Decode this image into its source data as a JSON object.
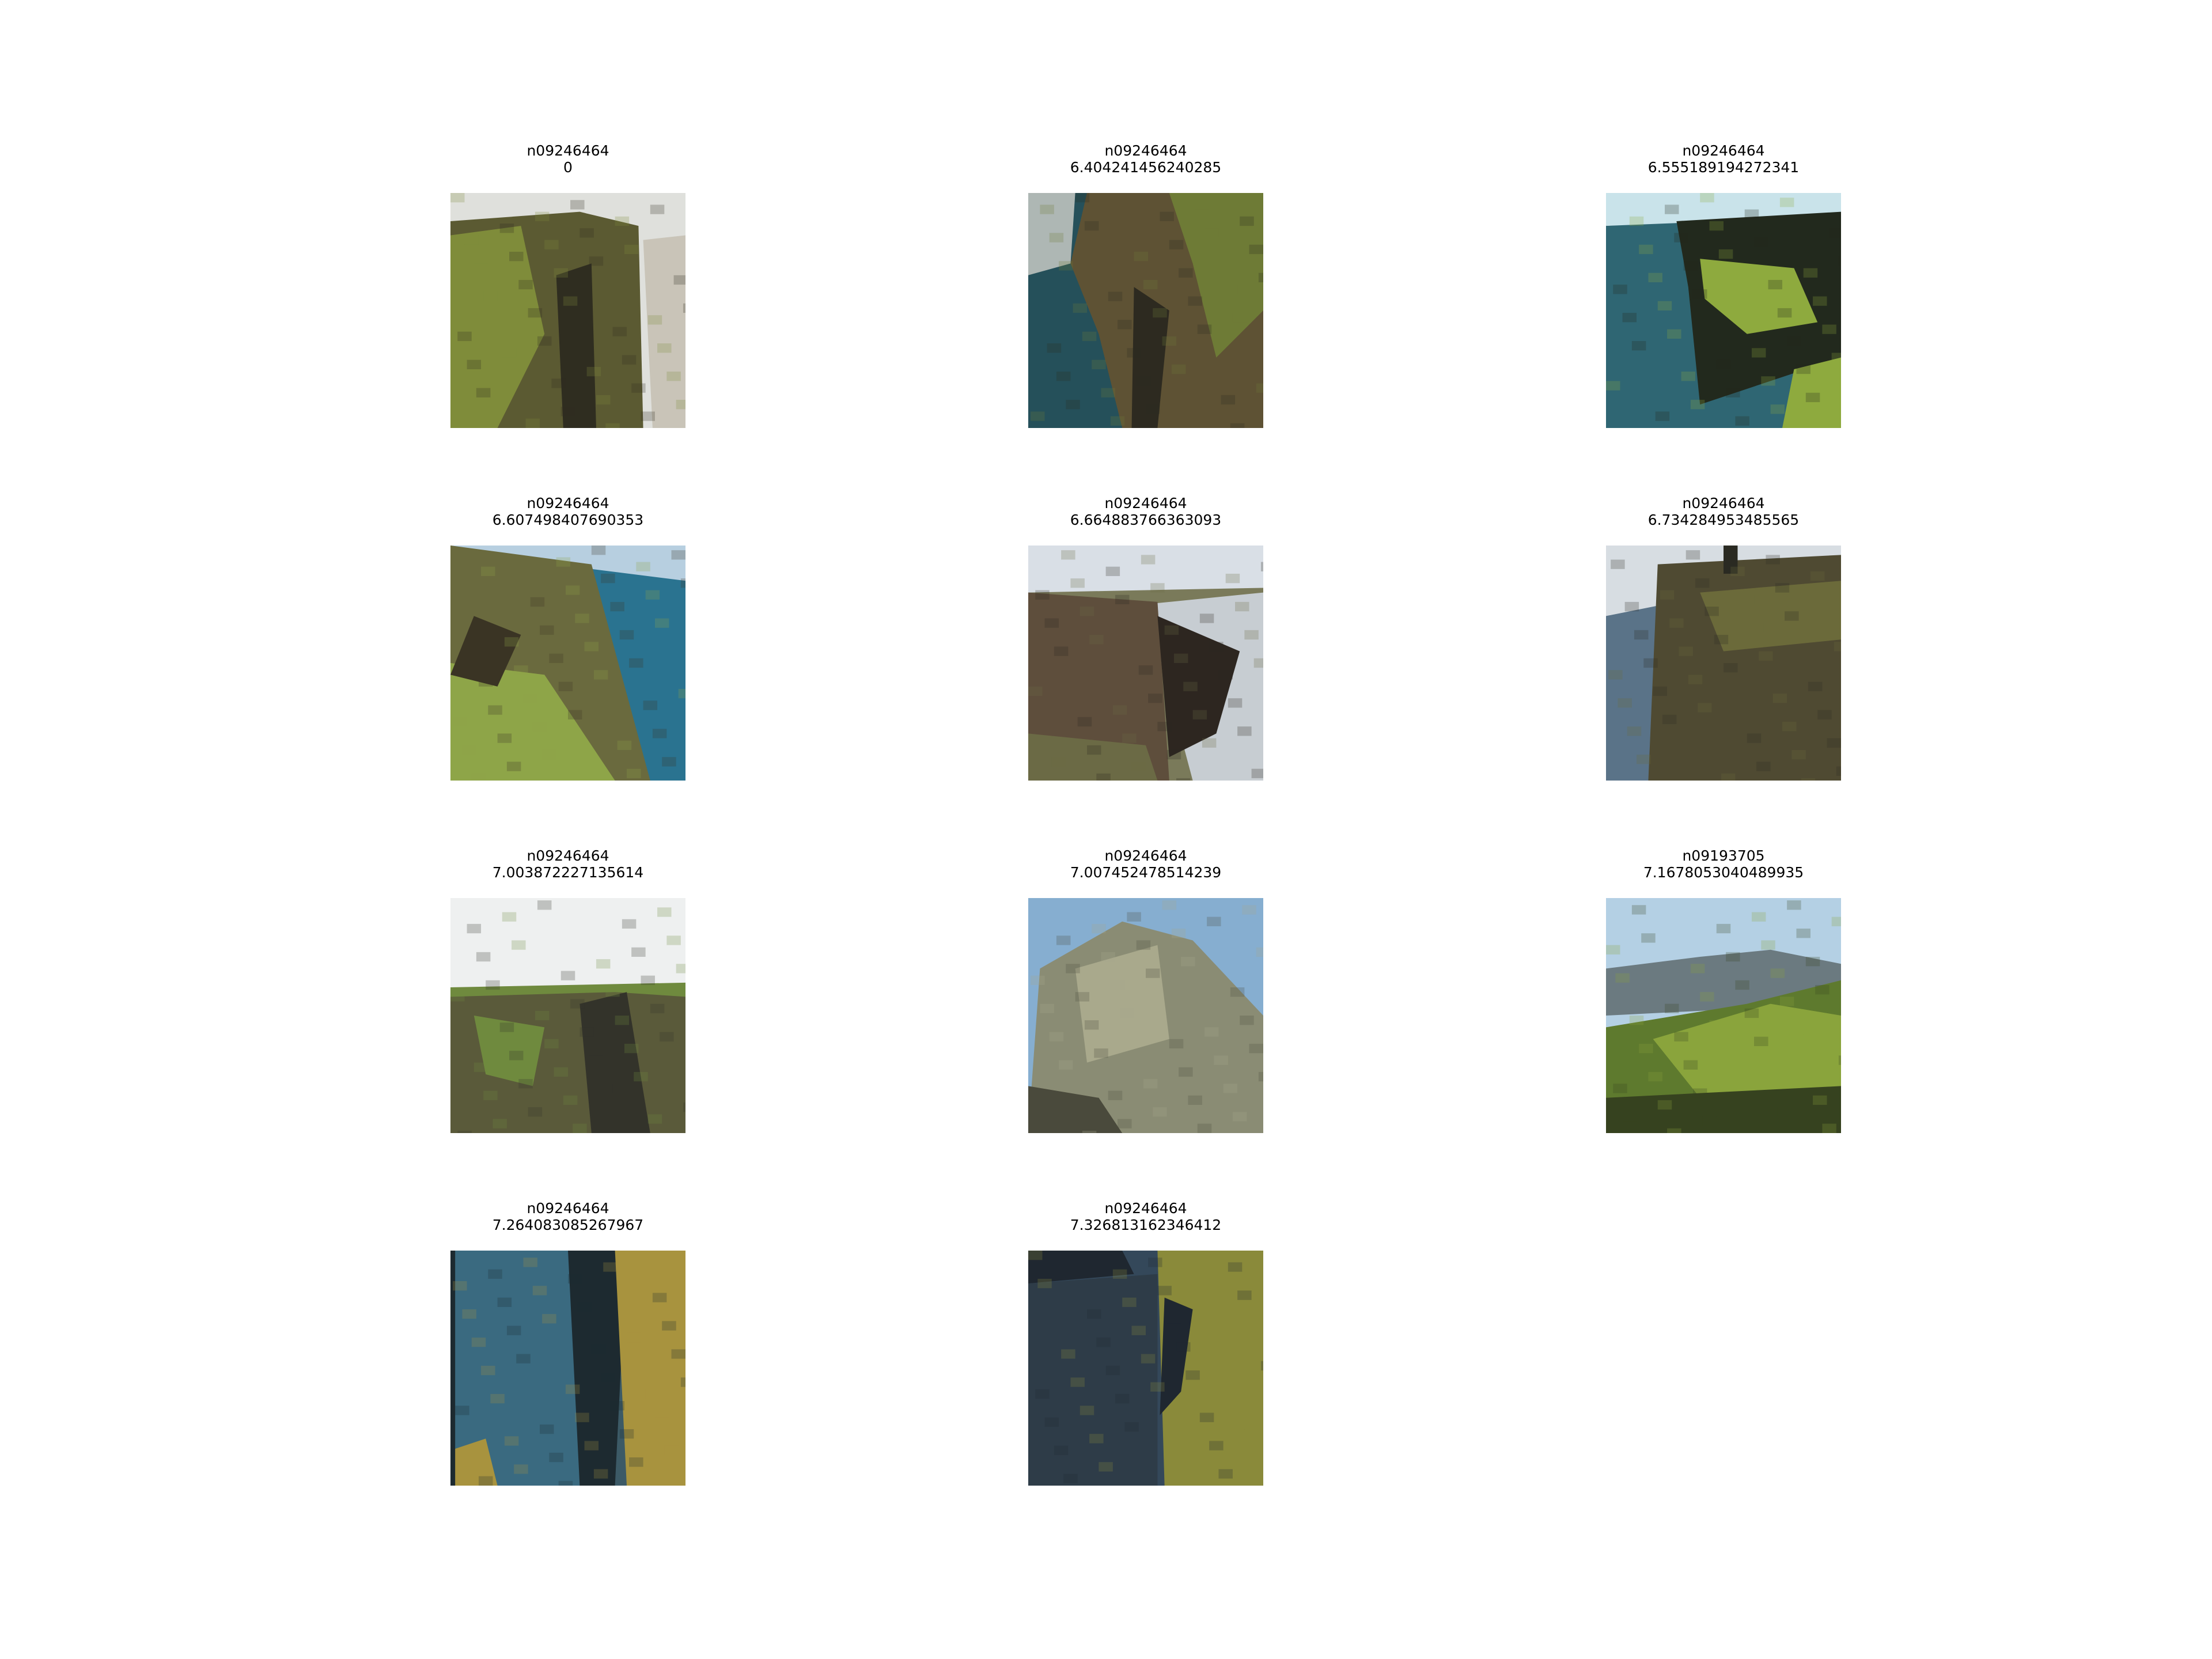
{
  "results": [
    {
      "label": "n09246464",
      "score": "0",
      "colors": {
        "sky": "#dfe0dc",
        "main": "#5b5a32",
        "accent": "#7f8c3a",
        "dark": "#2f2d20",
        "water": "#c9c4b8"
      }
    },
    {
      "label": "n09246464",
      "score": "6.404241456240285",
      "colors": {
        "sky": "#aeb7b4",
        "main": "#5e5234",
        "accent": "#6e7b36",
        "dark": "#2d2a20",
        "water": "#25505a"
      }
    },
    {
      "label": "n09246464",
      "score": "6.555189194272341",
      "colors": {
        "sky": "#c9e3ea",
        "main": "#3e4a2c",
        "accent": "#8eaa3e",
        "dark": "#22291d",
        "water": "#2f6673"
      }
    },
    {
      "label": "n09246464",
      "score": "6.607498407690353",
      "colors": {
        "sky": "#b7cfe0",
        "main": "#6a6a3e",
        "accent": "#8ea548",
        "dark": "#3a3424",
        "water": "#2a7390"
      }
    },
    {
      "label": "n09246464",
      "score": "6.664883766363093",
      "colors": {
        "sky": "#d9dfe6",
        "main": "#5e4e3c",
        "accent": "#6b6a45",
        "dark": "#2d2620",
        "water": "#c7cdd2"
      }
    },
    {
      "label": "n09246464",
      "score": "6.734284953485565",
      "colors": {
        "sky": "#d7dde2",
        "main": "#4f4a32",
        "accent": "#6b6a3a",
        "dark": "#2a2a22",
        "water": "#5a7388"
      }
    },
    {
      "label": "n09246464",
      "score": "7.003872227135614",
      "colors": {
        "sky": "#eef0f0",
        "main": "#5a5a3a",
        "accent": "#6f8a3e",
        "dark": "#33332a",
        "water": "#dfe2e2"
      }
    },
    {
      "label": "n09246464",
      "score": "7.007452478514239",
      "colors": {
        "sky": "#86aed0",
        "main": "#8a8c74",
        "accent": "#a9a98c",
        "dark": "#4a4a3c",
        "water": "#9fb9cf"
      }
    },
    {
      "label": "n09193705",
      "score": "7.1678053040489935",
      "colors": {
        "sky": "#b4d0e4",
        "main": "#5e7a2e",
        "accent": "#8aa43c",
        "dark": "#36421f",
        "water": "#6b7a80"
      }
    },
    {
      "label": "n09246464",
      "score": "7.264083085267967",
      "colors": {
        "sky": "#3d6a85",
        "main": "#3c5a66",
        "accent": "#a8933e",
        "dark": "#1d2a30",
        "water": "#3a6a80"
      }
    },
    {
      "label": "n09246464",
      "score": "7.326813162346412",
      "colors": {
        "sky": "#3a4c5a",
        "main": "#2e3c48",
        "accent": "#8a8a3a",
        "dark": "#1f2730",
        "water": "#34485a"
      }
    }
  ]
}
